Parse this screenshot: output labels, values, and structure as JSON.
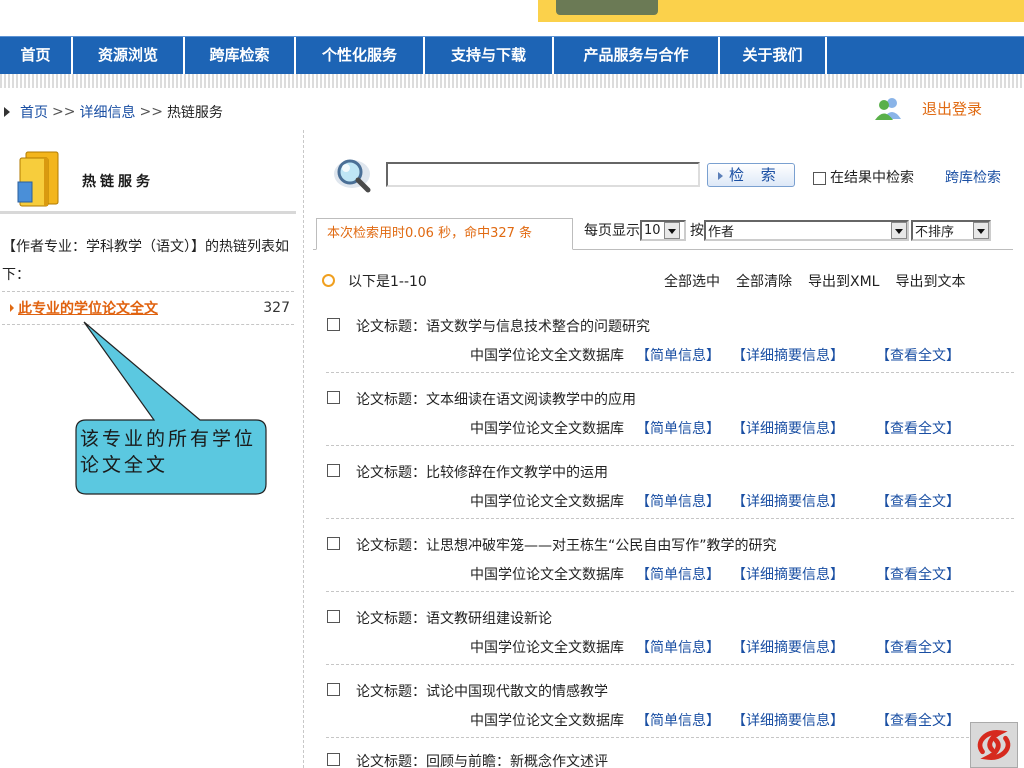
{
  "nav": {
    "items": [
      "首页",
      "资源浏览",
      "跨库检索",
      "个性化服务",
      "支持与下载",
      "产品服务与合作",
      "关于我们"
    ]
  },
  "breadcrumb": {
    "home": "首页",
    "sep1": ">>",
    "detail": "详细信息",
    "sep2": ">>",
    "current": "热链服务"
  },
  "logout": "退出登录",
  "sidebar": {
    "title": "热链服务",
    "description": "【作者专业：学科教学（语文）】的热链列表如下：",
    "link_label": "此专业的学位论文全文",
    "link_count": "327"
  },
  "callout": "该专业的所有学位论文全文",
  "search": {
    "button_label": "检 索",
    "within_label": "在结果中检索",
    "cross_label": "跨库检索"
  },
  "result_bar": {
    "stat": "本次检索用时0.06 秒，命中327 条",
    "per_page_label": "每页显示",
    "per_page_value": "10",
    "by_label": "按",
    "field_value": "作者",
    "order_value": "不排序"
  },
  "results_header": {
    "range": "以下是1--10",
    "select_all": "全部选中",
    "clear_all": "全部清除",
    "export_xml": "导出到XML",
    "export_text": "导出到文本"
  },
  "results": [
    {
      "title": "论文标题：语文数学与信息技术整合的问题研究",
      "db": "中国学位论文全文数据库",
      "brief": "【简单信息】",
      "abstract": "【详细摘要信息】",
      "full": "【查看全文】"
    },
    {
      "title": "论文标题：文本细读在语文阅读教学中的应用",
      "db": "中国学位论文全文数据库",
      "brief": "【简单信息】",
      "abstract": "【详细摘要信息】",
      "full": "【查看全文】"
    },
    {
      "title": "论文标题：比较修辞在作文教学中的运用",
      "db": "中国学位论文全文数据库",
      "brief": "【简单信息】",
      "abstract": "【详细摘要信息】",
      "full": "【查看全文】"
    },
    {
      "title": "论文标题：让思想冲破牢笼——对王栋生“公民自由写作”教学的研究",
      "db": "中国学位论文全文数据库",
      "brief": "【简单信息】",
      "abstract": "【详细摘要信息】",
      "full": "【查看全文】"
    },
    {
      "title": "论文标题：语文教研组建设新论",
      "db": "中国学位论文全文数据库",
      "brief": "【简单信息】",
      "abstract": "【详细摘要信息】",
      "full": "【查看全文】"
    },
    {
      "title": "论文标题：试论中国现代散文的情感教学",
      "db": "中国学位论文全文数据库",
      "brief": "【简单信息】",
      "abstract": "【详细摘要信息】",
      "full": "【查看全文】"
    },
    {
      "title": "论文标题：回顾与前瞻：新概念作文述评",
      "db": "",
      "brief": "",
      "abstract": "",
      "full": ""
    }
  ],
  "colors": {
    "nav_bg": "#1d64b5",
    "link_blue": "#1a4fa3",
    "accent_orange": "#e06a12",
    "callout_fill": "#5bc8e0"
  }
}
